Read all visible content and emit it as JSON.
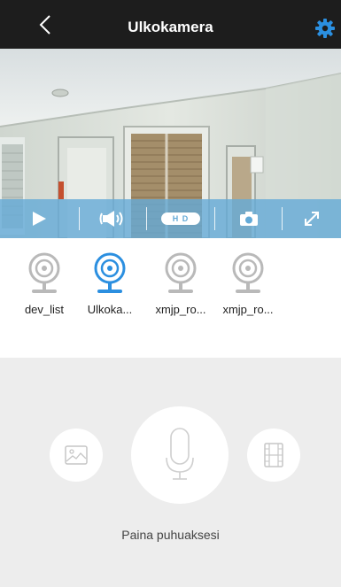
{
  "header": {
    "title": "Ulkokamera",
    "back_icon": "chevron-left-icon",
    "settings_icon": "gear-icon",
    "accent_color": "#2b8fe0"
  },
  "player": {
    "controls": [
      {
        "name": "play-icon"
      },
      {
        "name": "speaker-icon"
      },
      {
        "name": "hd-toggle",
        "label": "H D"
      },
      {
        "name": "camera-icon"
      },
      {
        "name": "fullscreen-icon"
      }
    ],
    "bar_color": "#64aad7"
  },
  "devices": [
    {
      "label": "dev_list",
      "selected": false
    },
    {
      "label": "Ulkoka...",
      "selected": true
    },
    {
      "label": "xmjp_ro...",
      "selected": false
    },
    {
      "label": "xmjp_ro...",
      "selected": false
    }
  ],
  "talk": {
    "hint": "Paina puhuaksesi",
    "icons": [
      "image-icon",
      "microphone-icon",
      "film-icon"
    ]
  }
}
